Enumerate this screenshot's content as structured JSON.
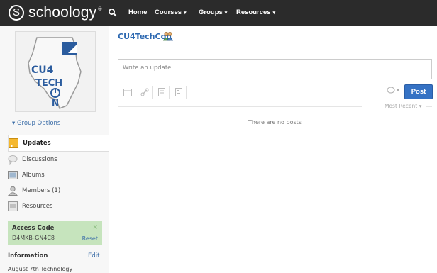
{
  "brand": {
    "logo_letter": "S",
    "name": "schoology",
    "registered": "®"
  },
  "nav": {
    "home": "Home",
    "courses": "Courses",
    "groups": "Groups",
    "resources": "Resources",
    "caret": "▾"
  },
  "sidebar": {
    "group_options": "▾  Group Options",
    "items": [
      {
        "label": "Updates",
        "icon": "updates-icon"
      },
      {
        "label": "Discussions",
        "icon": "discussions-icon"
      },
      {
        "label": "Albums",
        "icon": "albums-icon"
      },
      {
        "label": "Members (1)",
        "icon": "members-icon"
      },
      {
        "label": "Resources",
        "icon": "resources-icon"
      }
    ],
    "access_code": {
      "title": "Access Code",
      "code": "D4MKB-GN4C8",
      "close": "×",
      "reset": "Reset"
    },
    "information": {
      "title": "Information",
      "edit": "Edit",
      "description": "August 7th Technology"
    }
  },
  "main": {
    "group_title": "CU4TechCon",
    "update_placeholder": "Write an update",
    "post_button": "Post",
    "sort_label": "Most Recent ▾",
    "empty_message": "There are no posts"
  },
  "colors": {
    "topbar": "#2b2b2b",
    "link": "#2e69b1",
    "post_button": "#3572c4",
    "access_bg": "#c6e4bd"
  }
}
